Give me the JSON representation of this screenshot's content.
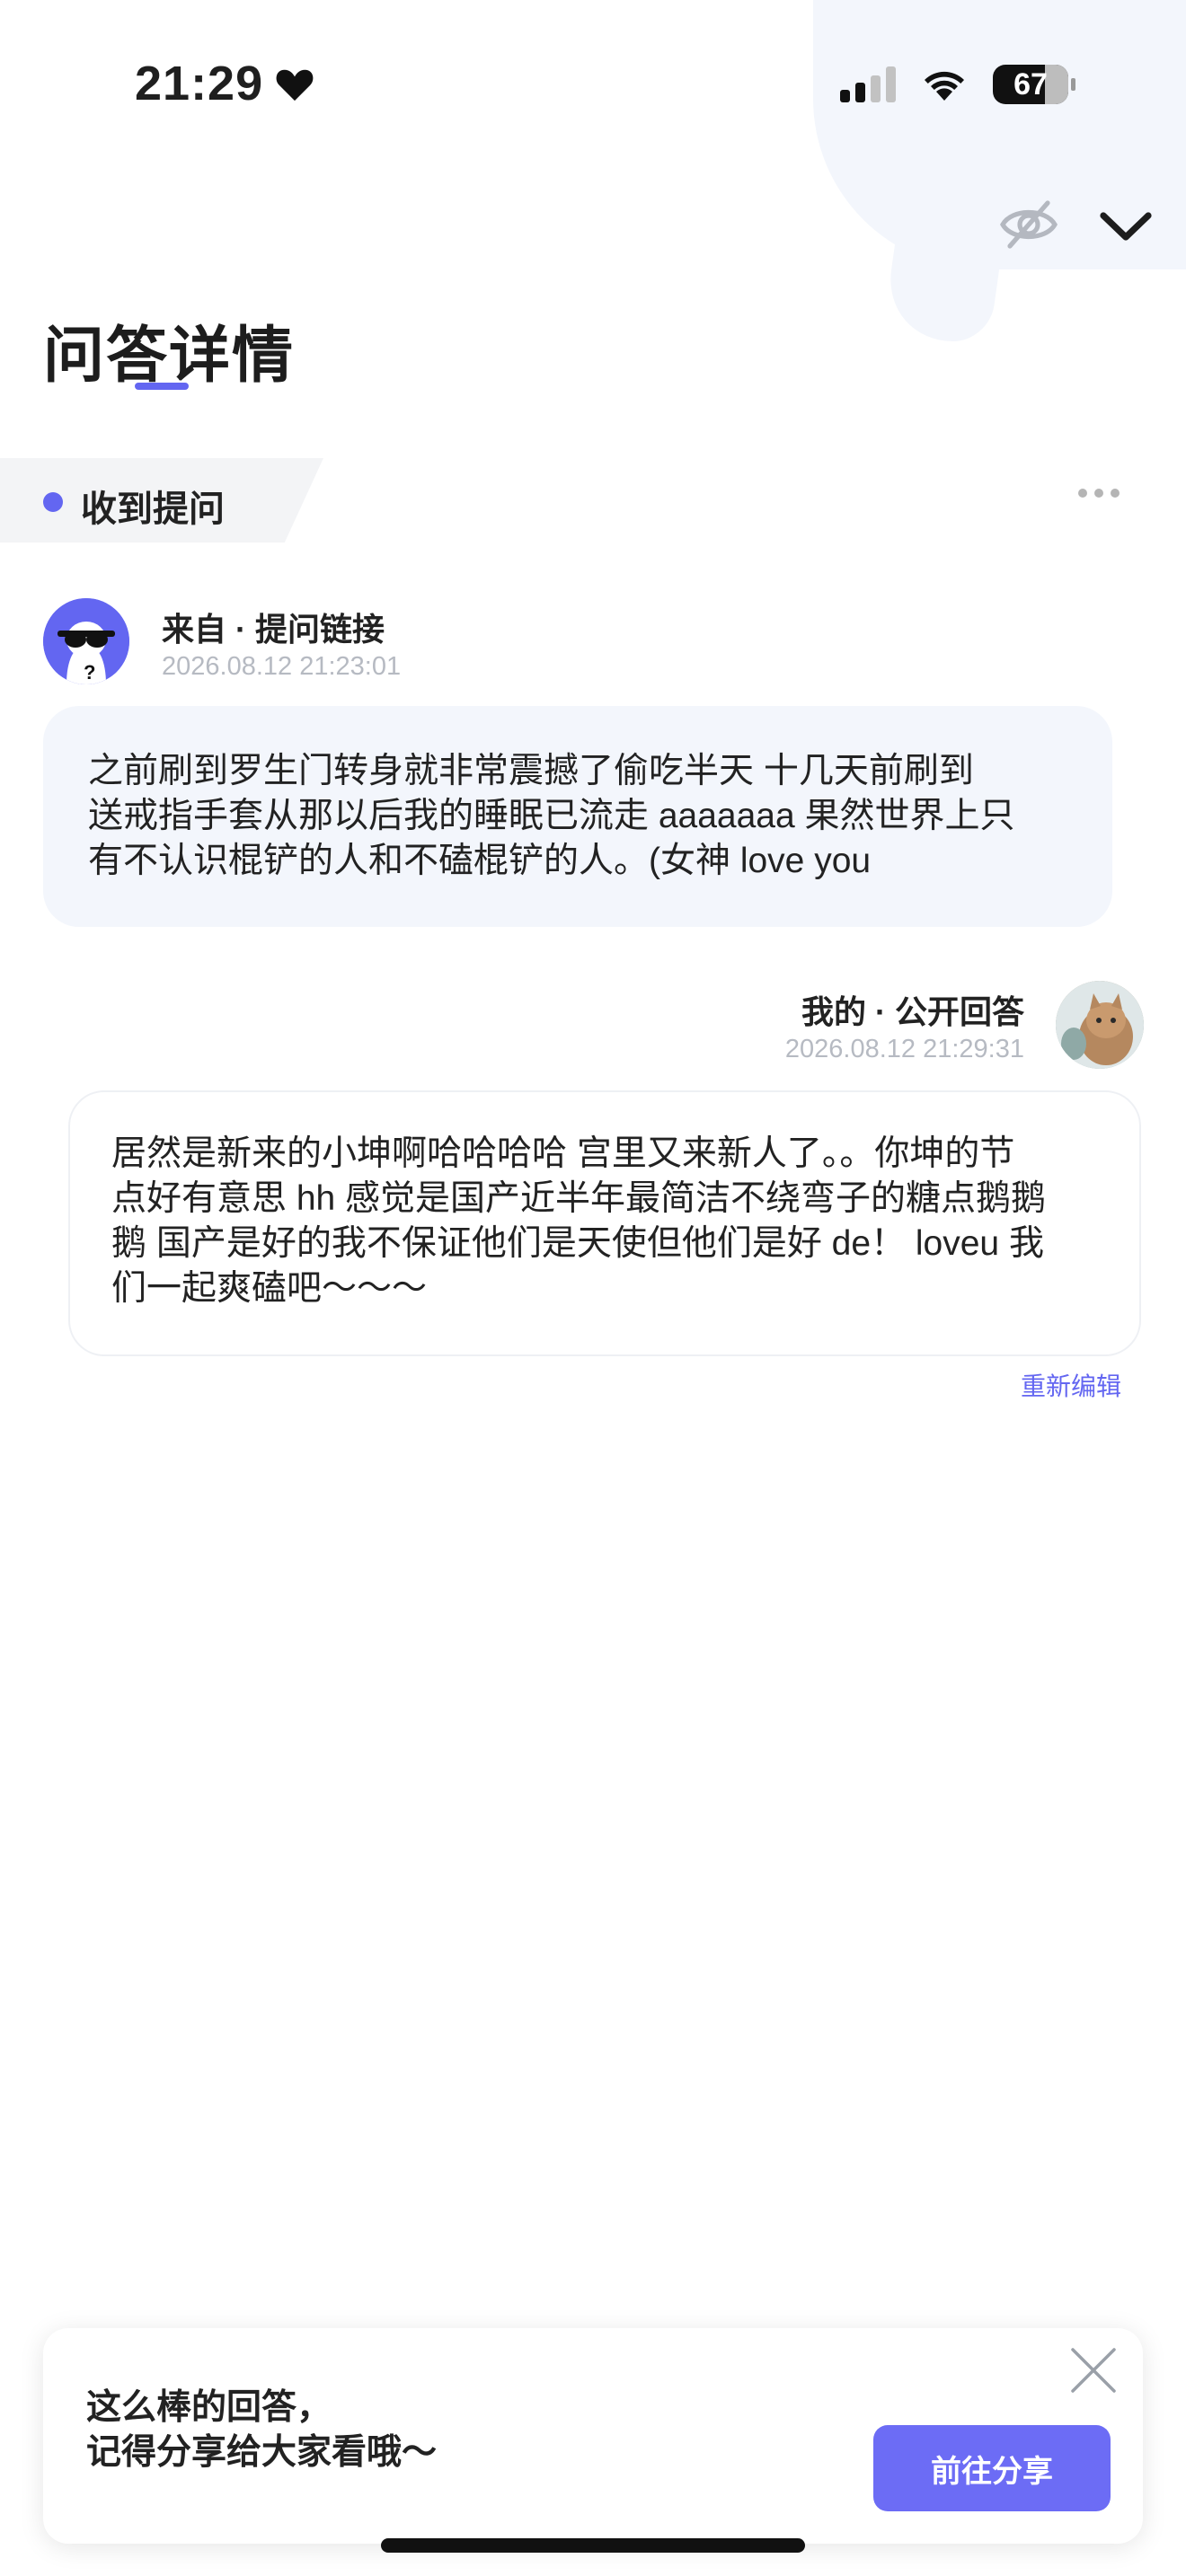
{
  "status_bar": {
    "time": "21:29",
    "battery": "67"
  },
  "page": {
    "title": "问答详情"
  },
  "received": {
    "label": "收到提问"
  },
  "question": {
    "source": "来自 · 提问链接",
    "time": "2026.08.12 21:23:01",
    "lines": [
      "之前刷到罗生门转身就非常震撼了偷吃半天  十几天前刷到",
      "送戒指手套从那以后我的睡眠已流走 aaaaaaa 果然世界上只",
      "有不认识棍铲的人和不磕棍铲的人。(女神 love you"
    ]
  },
  "answer": {
    "label": "我的 · 公开回答",
    "time": "2026.08.12 21:29:31",
    "lines": [
      "居然是新来的小坤啊哈哈哈哈 宫里又来新人了。。你坤的节",
      "点好有意思 hh 感觉是国产近半年最简洁不绕弯子的糖点鹅鹅",
      "鹅 国产是好的我不保证他们是天使但他们是好 de！ loveu 我",
      "们一起爽磕吧～～～"
    ],
    "reedit": "重新编辑"
  },
  "share": {
    "line1": "这么棒的回答，",
    "line2": "记得分享给大家看哦～",
    "button": "前往分享"
  },
  "colors": {
    "accent": "#6366f1",
    "bubble": "#f3f6fc",
    "share_button": "#6c6cf5"
  },
  "icons": [
    "heart-icon",
    "signal-icon",
    "wifi-icon",
    "battery-icon",
    "eye-off-icon",
    "chevron-down-icon",
    "more-icon",
    "close-icon"
  ]
}
